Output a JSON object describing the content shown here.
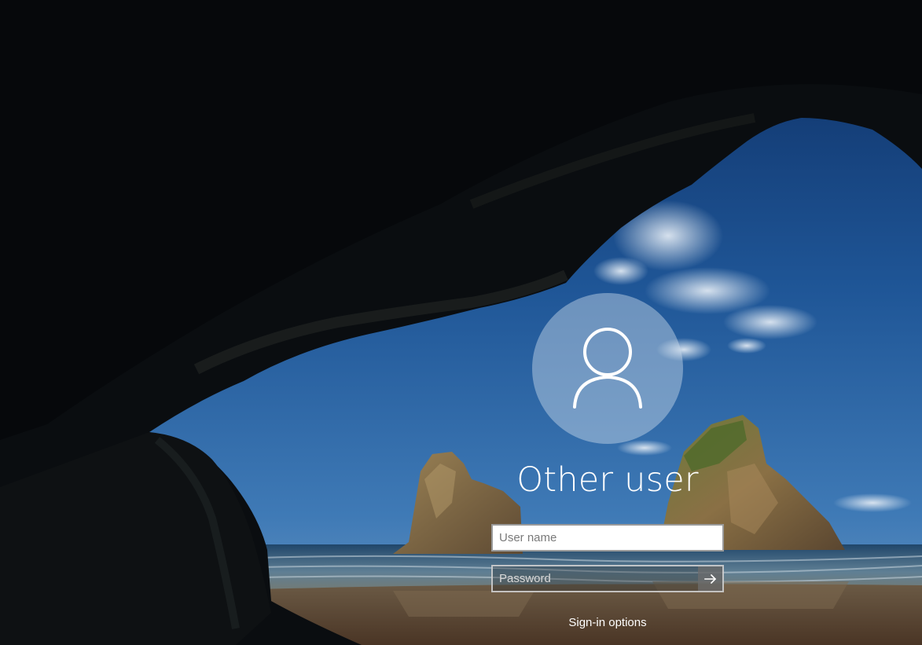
{
  "login": {
    "user_display_name": "Other user",
    "username_field": {
      "placeholder": "User name",
      "value": ""
    },
    "password_field": {
      "placeholder": "Password",
      "value": ""
    },
    "submit_icon": "arrow-right-icon",
    "signin_options_label": "Sign-in options"
  },
  "icons": {
    "avatar": "user-silhouette-icon",
    "submit": "arrow-right-icon"
  },
  "colors": {
    "text": "#ffffff",
    "avatar_fill": "#a9b8c6",
    "input_bg": "#ffffff",
    "submit_bg": "#6e6e6e"
  }
}
